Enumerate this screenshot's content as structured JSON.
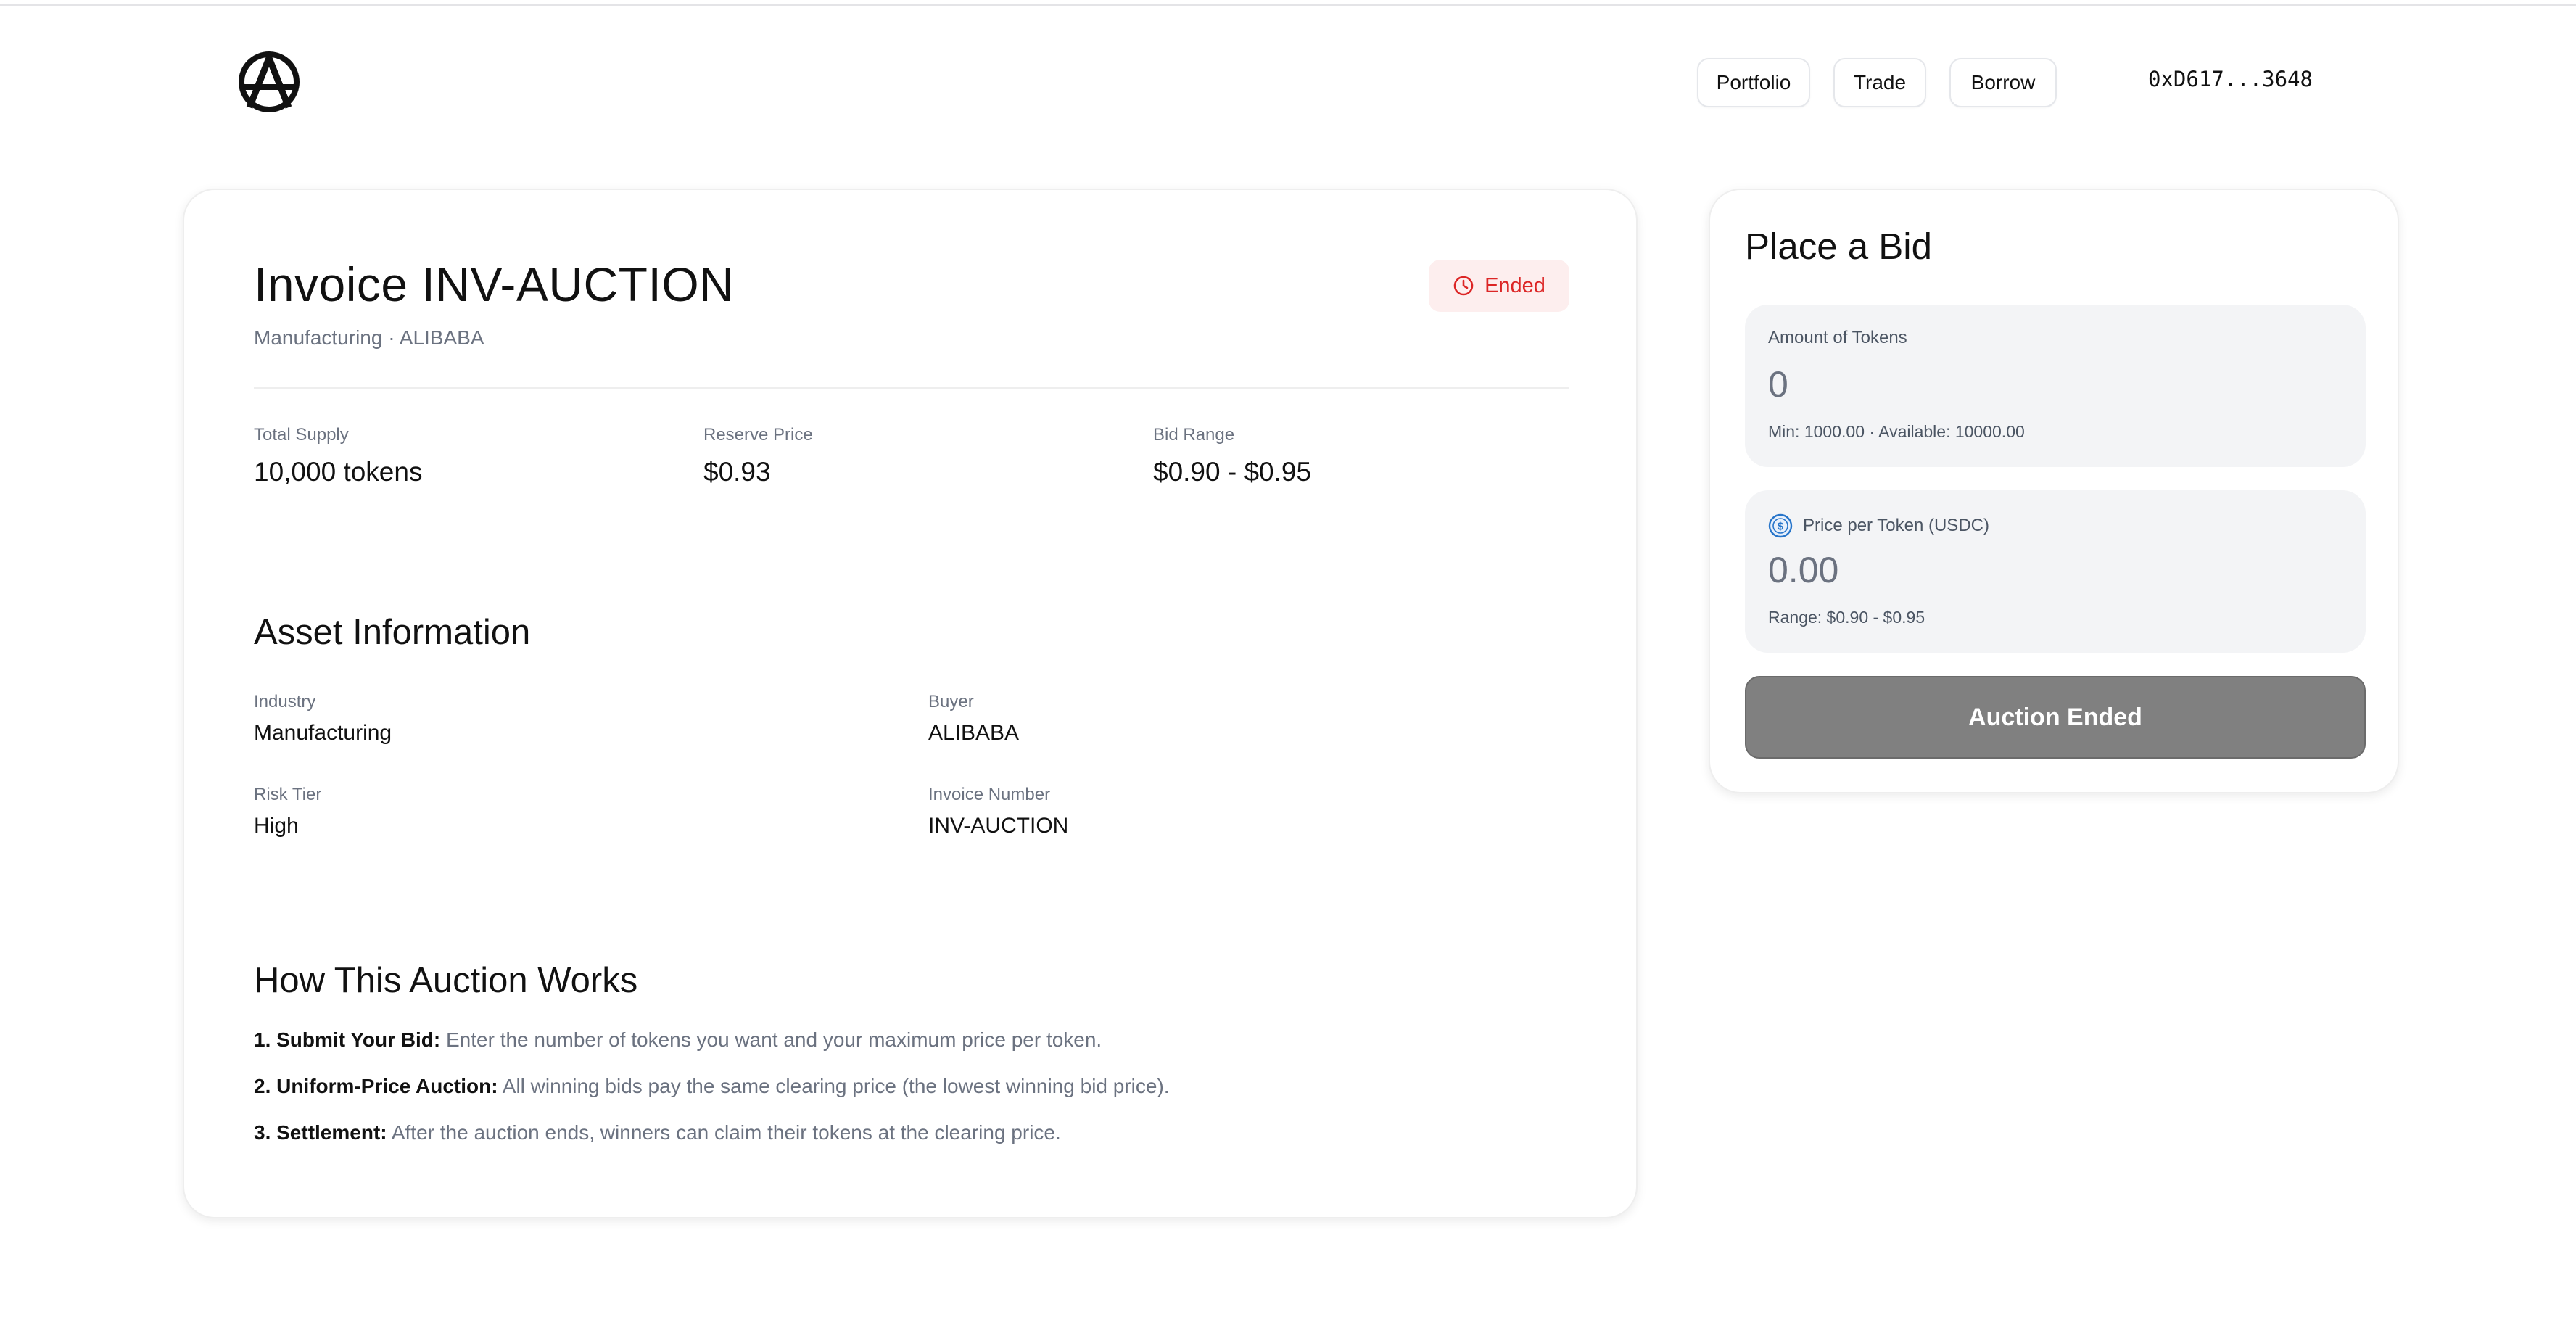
{
  "header": {
    "logo_icon": "anarchy-a-logo-icon",
    "nav": [
      "Portfolio",
      "Trade",
      "Borrow"
    ],
    "wallet_address": "0xD617...3648"
  },
  "invoice": {
    "title": "Invoice INV-AUCTION",
    "subtitle": "Manufacturing · ALIBABA",
    "status": {
      "label": "Ended",
      "icon": "clock-icon",
      "color": "#dc2626"
    },
    "stats": [
      {
        "label": "Total Supply",
        "value": "10,000 tokens"
      },
      {
        "label": "Reserve Price",
        "value": "$0.93"
      },
      {
        "label": "Bid Range",
        "value": "$0.90 - $0.95"
      }
    ]
  },
  "asset_info": {
    "title": "Asset Information",
    "fields": [
      {
        "label": "Industry",
        "value": "Manufacturing"
      },
      {
        "label": "Buyer",
        "value": "ALIBABA"
      },
      {
        "label": "Risk Tier",
        "value": "High"
      },
      {
        "label": "Invoice Number",
        "value": "INV-AUCTION"
      }
    ]
  },
  "how_it_works": {
    "title": "How This Auction Works",
    "steps": [
      {
        "title": "1. Submit Your Bid:",
        "text": "Enter the number of tokens you want and your maximum price per token."
      },
      {
        "title": "2. Uniform-Price Auction:",
        "text": "All winning bids pay the same clearing price (the lowest winning bid price)."
      },
      {
        "title": "3. Settlement:",
        "text": "After the auction ends, winners can claim their tokens at the clearing price."
      }
    ]
  },
  "bid_panel": {
    "title": "Place a Bid",
    "amount": {
      "label": "Amount of Tokens",
      "placeholder": "0",
      "hint": "Min: 1000.00 · Available: 10000.00"
    },
    "price": {
      "label": "Price per Token (USDC)",
      "icon": "usdc-coin-icon",
      "placeholder": "0.00",
      "hint": "Range: $0.90 - $0.95"
    },
    "button_label": "Auction Ended"
  },
  "colors": {
    "accent_usdc": "#2775ca",
    "ended_badge_bg": "#fdeeee",
    "disabled_button": "#808080"
  }
}
